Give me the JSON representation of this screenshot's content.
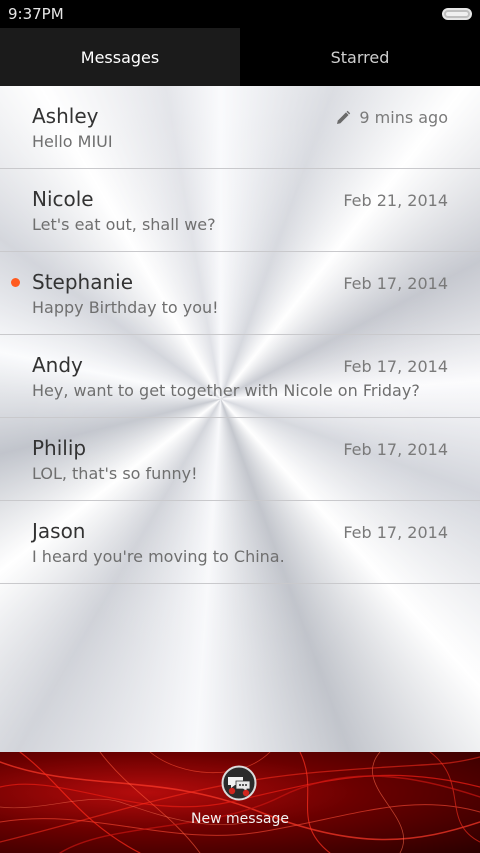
{
  "status_bar": {
    "time": "9:37PM",
    "battery_icon": "battery-icon"
  },
  "tabs": [
    {
      "label": "Messages",
      "active": true
    },
    {
      "label": "Starred",
      "active": false
    }
  ],
  "messages": [
    {
      "name": "Ashley",
      "preview": "Hello MIUI",
      "time": "9 mins ago",
      "draft": true,
      "unread": false
    },
    {
      "name": "Nicole",
      "preview": "Let's eat out, shall we?",
      "time": "Feb 21, 2014",
      "draft": false,
      "unread": false
    },
    {
      "name": "Stephanie",
      "preview": "Happy Birthday to you!",
      "time": "Feb 17, 2014",
      "draft": false,
      "unread": true
    },
    {
      "name": "Andy",
      "preview": "Hey, want to get together with Nicole on Friday?",
      "time": "Feb 17, 2014",
      "draft": false,
      "unread": false
    },
    {
      "name": "Philip",
      "preview": "LOL, that's so funny!",
      "time": "Feb 17, 2014",
      "draft": false,
      "unread": false
    },
    {
      "name": "Jason",
      "preview": "I heard you're moving to China.",
      "time": "Feb 17, 2014",
      "draft": false,
      "unread": false
    }
  ],
  "bottom_bar": {
    "new_message_label": "New message",
    "new_message_icon": "new-message-icon"
  },
  "colors": {
    "unread_dot": "#ff5a1f",
    "bottom_bar_red": "#b50c0c",
    "active_tab": "#1b1b1b"
  }
}
